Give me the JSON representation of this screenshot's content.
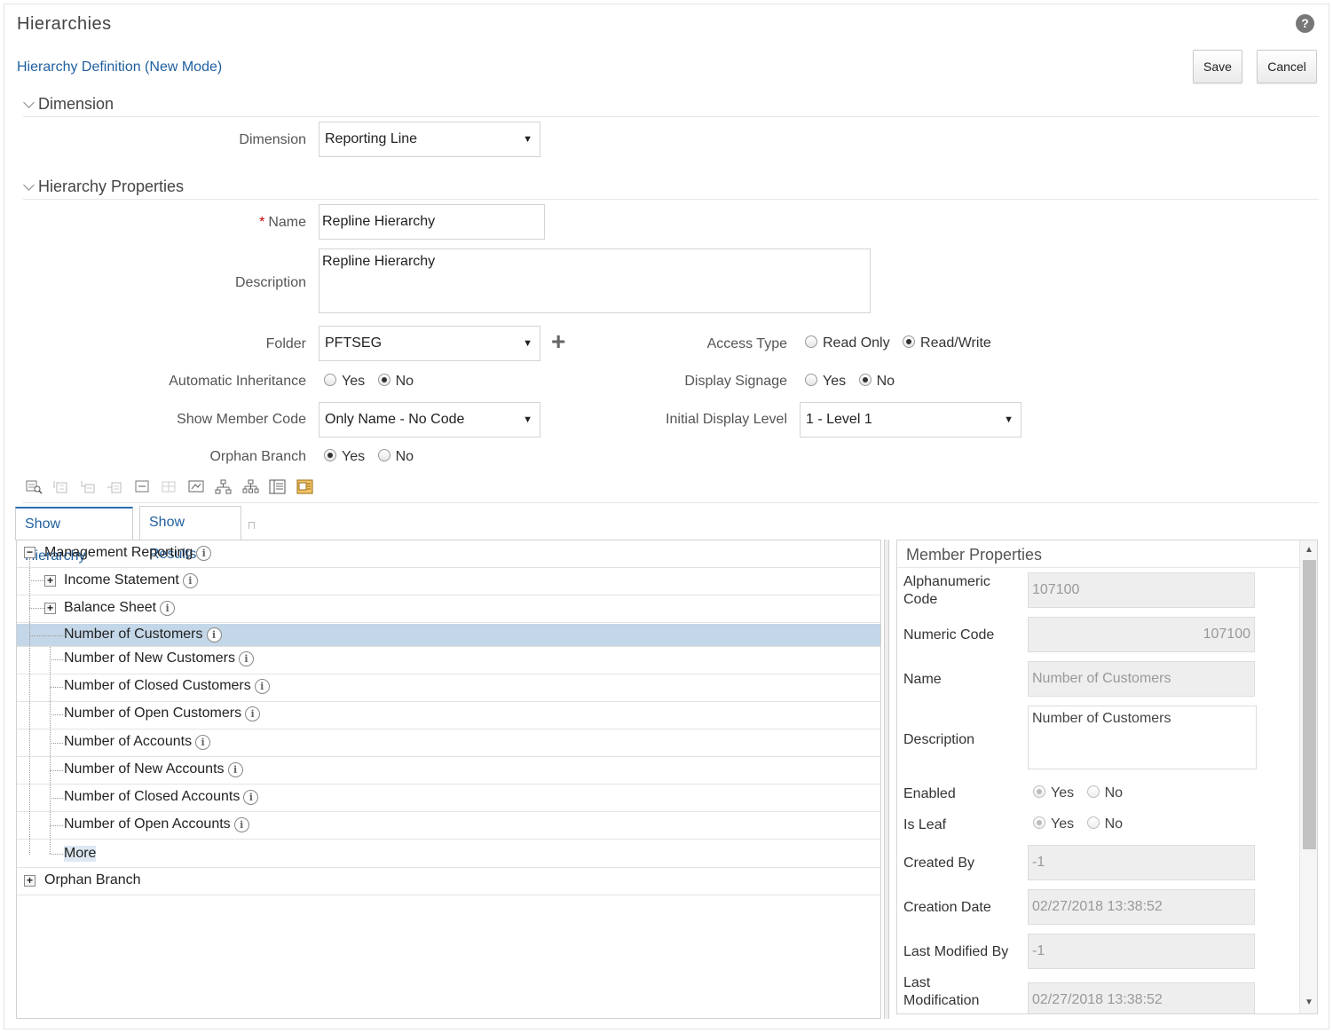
{
  "header": {
    "title": "Hierarchies",
    "help_glyph": "?",
    "subtitle": "Hierarchy Definition (New Mode)",
    "save_label": "Save",
    "cancel_label": "Cancel"
  },
  "dimension_section": {
    "title": "Dimension",
    "dimension_label": "Dimension",
    "dimension_value": "Reporting Line"
  },
  "properties_section": {
    "title": "Hierarchy Properties",
    "required_mark": "*",
    "name_label": "Name",
    "name_value": "Repline Hierarchy",
    "description_label": "Description",
    "description_value": "Repline Hierarchy",
    "folder_label": "Folder",
    "folder_value": "PFTSEG",
    "access_type_label": "Access Type",
    "access_read_only": "Read Only",
    "access_read_write": "Read/Write",
    "auto_inherit_label": "Automatic Inheritance",
    "display_signage_label": "Display Signage",
    "show_member_code_label": "Show Member Code",
    "show_member_code_value": "Only Name - No Code",
    "initial_display_level_label": "Initial Display Level",
    "initial_display_level_value": "1 - Level 1",
    "orphan_branch_label": "Orphan Branch",
    "yes": "Yes",
    "no": "No"
  },
  "tabs": {
    "show_hierarchy": "Show Hierarchy",
    "show_results": "Show Results"
  },
  "tree": {
    "root": "Management Reporting",
    "children": [
      "Income Statement",
      "Balance Sheet",
      "Number of Customers",
      "Number of New Customers",
      "Number of Closed Customers",
      "Number of Open Customers",
      "Number of Accounts",
      "Number of New Accounts",
      "Number of Closed Accounts",
      "Number of Open Accounts",
      "More"
    ],
    "orphan": "Orphan Branch",
    "info_glyph": "i"
  },
  "member_properties": {
    "title": "Member Properties",
    "alphanumeric_code_label_1": "Alphanumeric",
    "alphanumeric_code_label_2": "Code",
    "alphanumeric_code_value": "107100",
    "numeric_code_label": "Numeric Code",
    "numeric_code_value": "107100",
    "name_label": "Name",
    "name_value": "Number of Customers",
    "description_label": "Description",
    "description_value": "Number of Customers",
    "enabled_label": "Enabled",
    "is_leaf_label": "Is Leaf",
    "yes": "Yes",
    "no": "No",
    "created_by_label": "Created By",
    "created_by_value": "-1",
    "creation_date_label": "Creation Date",
    "creation_date_value": "02/27/2018 13:38:52",
    "last_modified_by_label": "Last Modified By",
    "last_modified_by_value": "-1",
    "last_modification_label_1": "Last",
    "last_modification_label_2": "Modification",
    "last_modification_value": "02/27/2018 13:38:52"
  }
}
